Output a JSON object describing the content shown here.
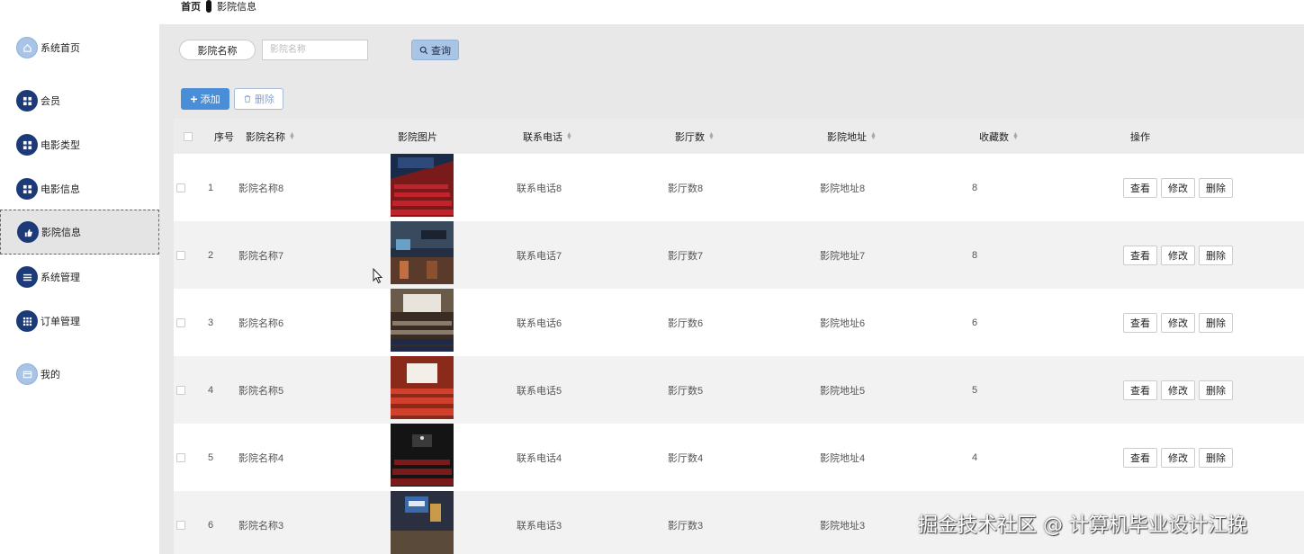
{
  "breadcrumb": {
    "home": "首页",
    "current": "影院信息"
  },
  "sidebar": {
    "items": [
      {
        "label": "系统首页",
        "icon": "home-icon"
      },
      {
        "label": "会员",
        "icon": "grid-icon"
      },
      {
        "label": "电影类型",
        "icon": "grid-icon"
      },
      {
        "label": "电影信息",
        "icon": "grid-icon"
      },
      {
        "label": "影院信息",
        "icon": "thumb-icon",
        "active": true
      },
      {
        "label": "系统管理",
        "icon": "list-icon"
      },
      {
        "label": "订单管理",
        "icon": "apps-icon"
      },
      {
        "label": "我的",
        "icon": "card-icon"
      }
    ]
  },
  "search": {
    "label": "影院名称",
    "placeholder": "影院名称",
    "button": "查询"
  },
  "toolbar": {
    "add": "添加",
    "delete": "删除"
  },
  "table": {
    "headers": {
      "index": "序号",
      "name": "影院名称",
      "image": "影院图片",
      "phone": "联系电话",
      "halls": "影厅数",
      "address": "影院地址",
      "favorites": "收藏数",
      "actions": "操作"
    },
    "rows": [
      {
        "index": "1",
        "name": "影院名称8",
        "phone": "联系电话8",
        "halls": "影厅数8",
        "address": "影院地址8",
        "favorites": "8"
      },
      {
        "index": "2",
        "name": "影院名称7",
        "phone": "联系电话7",
        "halls": "影厅数7",
        "address": "影院地址7",
        "favorites": "8"
      },
      {
        "index": "3",
        "name": "影院名称6",
        "phone": "联系电话6",
        "halls": "影厅数6",
        "address": "影院地址6",
        "favorites": "6"
      },
      {
        "index": "4",
        "name": "影院名称5",
        "phone": "联系电话5",
        "halls": "影厅数5",
        "address": "影院地址5",
        "favorites": "5"
      },
      {
        "index": "5",
        "name": "影院名称4",
        "phone": "联系电话4",
        "halls": "影厅数4",
        "address": "影院地址4",
        "favorites": "4"
      },
      {
        "index": "6",
        "name": "影院名称3",
        "phone": "联系电话3",
        "halls": "影厅数3",
        "address": "影院地址3",
        "favorites": ""
      }
    ],
    "row_actions": {
      "view": "查看",
      "edit": "修改",
      "delete": "删除"
    }
  },
  "watermark": "掘金技术社区 @ 计算机毕业设计江挽"
}
